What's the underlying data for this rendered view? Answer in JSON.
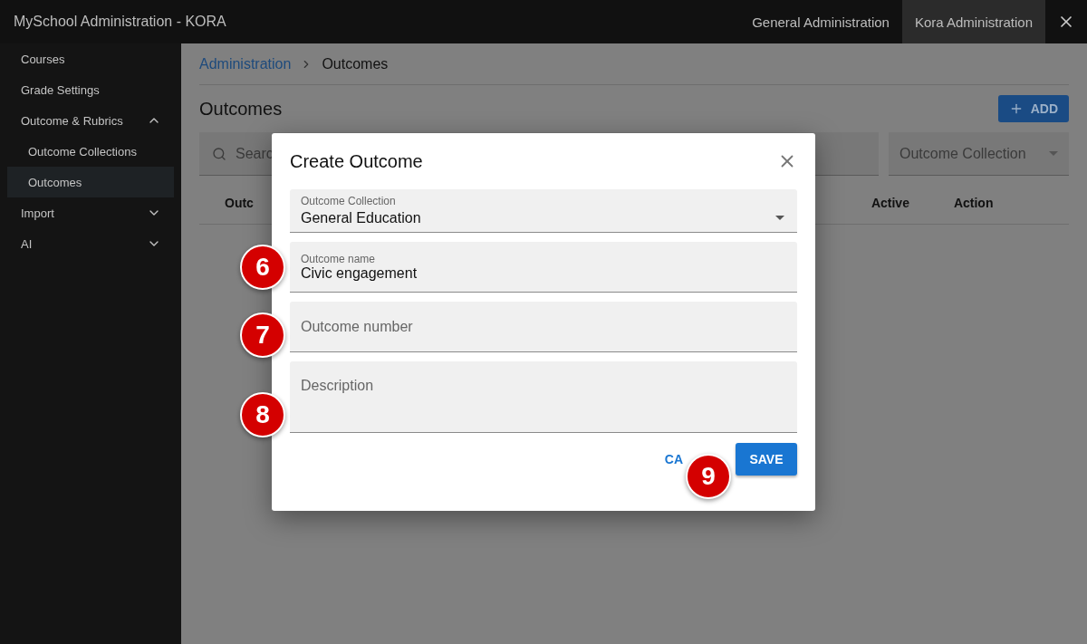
{
  "app_bar": {
    "title": "MySchool Administration - KORA",
    "tabs": [
      {
        "label": "General Administration",
        "selected": false
      },
      {
        "label": "Kora Administration",
        "selected": true
      }
    ]
  },
  "sidebar": {
    "items": [
      {
        "label": "Courses",
        "selected": false
      },
      {
        "label": "Grade Settings",
        "selected": false
      },
      {
        "label": "Outcome & Rubrics",
        "selected": false,
        "expanded": true,
        "children": [
          {
            "label": "Outcome Collections",
            "selected": false
          },
          {
            "label": "Outcomes",
            "selected": true
          }
        ]
      },
      {
        "label": "Import",
        "selected": false,
        "expanded": false
      },
      {
        "label": "AI",
        "selected": false,
        "expanded": false
      }
    ]
  },
  "breadcrumb": [
    "Administration",
    "Outcomes"
  ],
  "page_title": "Outcomes",
  "add_button": "ADD",
  "search": {
    "placeholder": "Searc"
  },
  "filter": {
    "placeholder": "Outcome Collection"
  },
  "table": {
    "columns": [
      "Outc",
      "Active",
      "Action"
    ]
  },
  "dialog": {
    "title": "Create Outcome",
    "fields": [
      {
        "kind": "select",
        "label": "Outcome Collection",
        "value": "General Education"
      },
      {
        "kind": "text",
        "label": "Outcome name",
        "value": "Civic engagement"
      },
      {
        "kind": "text",
        "placeholder": "Outcome number"
      },
      {
        "kind": "textarea",
        "placeholder": "Description"
      }
    ],
    "cancel": "CA",
    "save": "SAVE"
  },
  "annotations": [
    "6",
    "7",
    "8",
    "9"
  ]
}
